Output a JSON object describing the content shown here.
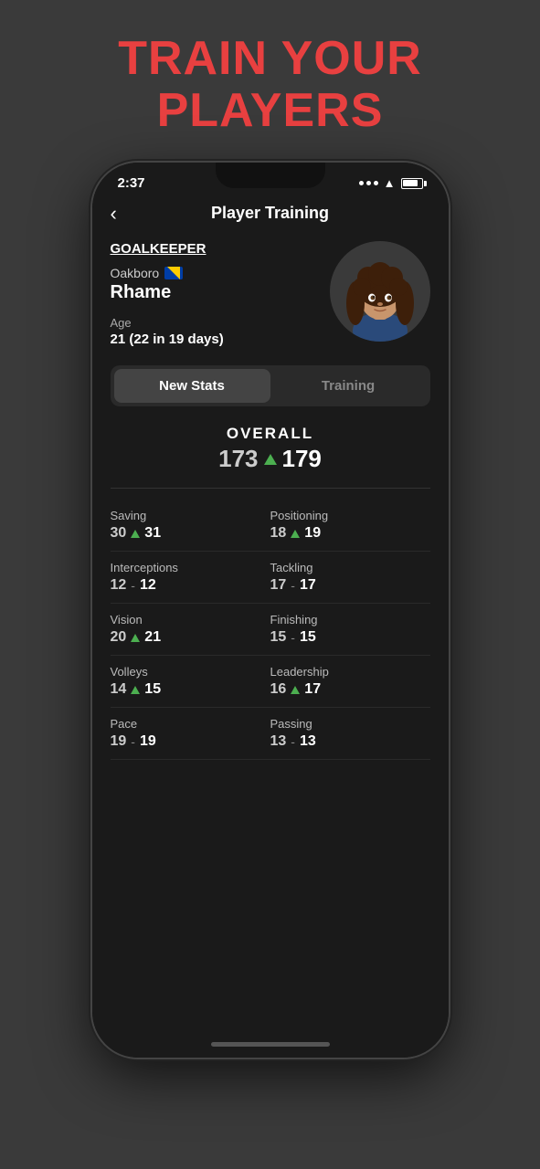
{
  "hero": {
    "line1": "TRAIN YOUR",
    "line2": "PLAYERS"
  },
  "statusBar": {
    "time": "2:37",
    "wifi": "wifi",
    "battery": "battery"
  },
  "nav": {
    "back": "‹",
    "title": "Player Training"
  },
  "player": {
    "position": "GOALKEEPER",
    "club": "Oakboro",
    "name": "Rhame",
    "ageLabel": "Age",
    "ageValue": "21 (22 in 19 days)"
  },
  "tabs": {
    "active": "New Stats",
    "inactive": "Training"
  },
  "overall": {
    "label": "OVERALL",
    "oldValue": "173",
    "newValue": "179"
  },
  "stats": [
    {
      "name": "Saving",
      "old": "30",
      "new": "31",
      "changed": true,
      "col": 0
    },
    {
      "name": "Positioning",
      "old": "18",
      "new": "19",
      "changed": true,
      "col": 1
    },
    {
      "name": "Interceptions",
      "old": "12",
      "new": "12",
      "changed": false,
      "col": 0
    },
    {
      "name": "Tackling",
      "old": "17",
      "new": "17",
      "changed": false,
      "col": 1
    },
    {
      "name": "Vision",
      "old": "20",
      "new": "21",
      "changed": true,
      "col": 0
    },
    {
      "name": "Finishing",
      "old": "15",
      "new": "15",
      "changed": false,
      "col": 1
    },
    {
      "name": "Volleys",
      "old": "14",
      "new": "15",
      "changed": true,
      "col": 0
    },
    {
      "name": "Leadership",
      "old": "16",
      "new": "17",
      "changed": true,
      "col": 1
    },
    {
      "name": "Pace",
      "old": "19",
      "new": "19",
      "changed": false,
      "col": 0
    },
    {
      "name": "Passing",
      "old": "13",
      "new": "13",
      "changed": false,
      "col": 1
    }
  ]
}
